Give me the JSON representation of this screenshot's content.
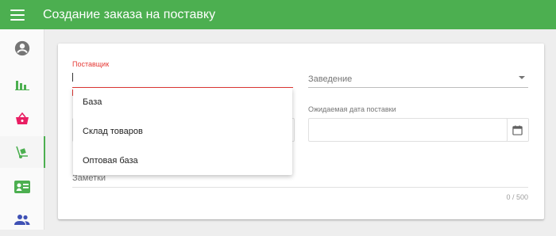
{
  "header": {
    "title": "Создание заказа на поставку"
  },
  "sidebar": {
    "items": [
      {
        "icon": "account-circle-icon",
        "color": "#757575"
      },
      {
        "icon": "bar-chart-icon",
        "color": "#4caf50"
      },
      {
        "icon": "basket-icon",
        "color": "#e91e63"
      },
      {
        "icon": "hand-truck-icon",
        "color": "#4caf50",
        "active": true
      },
      {
        "icon": "contact-card-icon",
        "color": "#4caf50"
      },
      {
        "icon": "people-icon",
        "color": "#3f51b5"
      }
    ]
  },
  "form": {
    "supplier_label": "Поставщик",
    "establishment_placeholder": "Заведение",
    "delivery_date_label": "Ожидаемая дата поставки",
    "notes_label": "Заметки",
    "notes_counter": "0 / 500"
  },
  "supplier_dropdown": {
    "options": [
      "База",
      "Склад товаров",
      "Оптовая база"
    ]
  },
  "colors": {
    "primary": "#4caf50",
    "error": "#e53935"
  }
}
